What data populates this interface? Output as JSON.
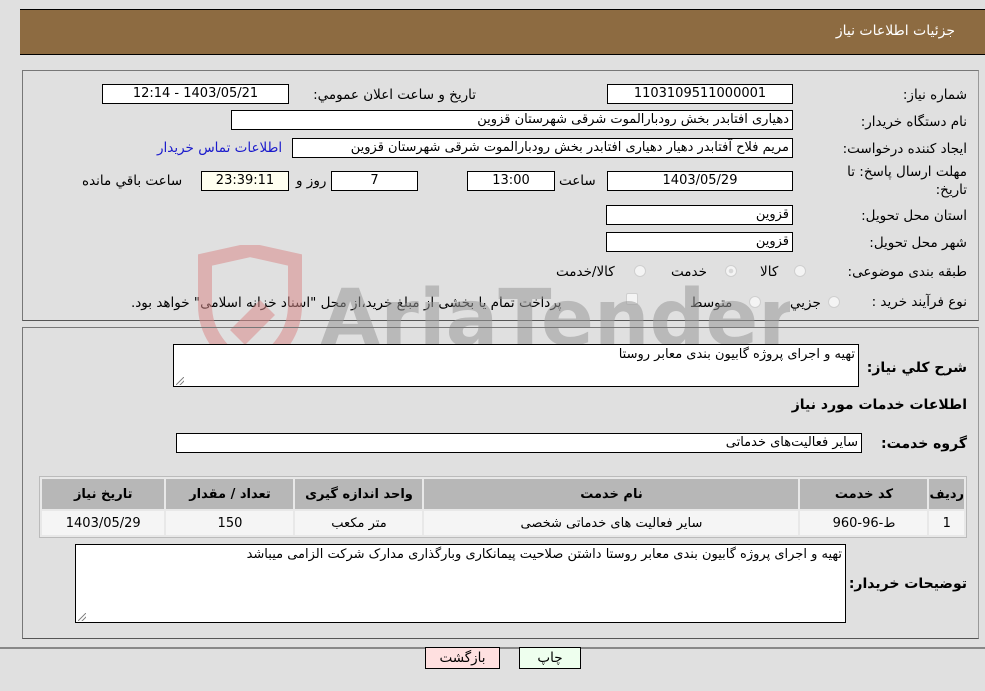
{
  "header": {
    "title": "جزئیات اطلاعات نیاز"
  },
  "details": {
    "need_number_label": "شماره نیاز:",
    "need_number": "1103109511000001",
    "announce_label": "تاریخ و ساعت اعلان عمومي:",
    "announce_value": "1403/05/21 - 12:14",
    "buyer_org_label": "نام دستگاه خریدار:",
    "buyer_org": "دهیاری افتابدر بخش رودبارالموت شرقی شهرستان قزوین",
    "creator_label": "ایجاد کننده درخواست:",
    "creator": "مریم فلاح آفتابدر دهیار دهیاری افتابدر بخش رودبارالموت شرقی شهرستان قزوین",
    "contact_link": "اطلاعات تماس خریدار",
    "deadline_label_line1": "مهلت ارسال پاسخ: تا",
    "deadline_label_line2": "تاریخ:",
    "deadline_date": "1403/05/29",
    "time_label": "ساعت",
    "deadline_time": "13:00",
    "days_value": "7",
    "days_label": "روز و",
    "remaining_time": "23:39:11",
    "remaining_label": "ساعت باقي مانده",
    "province_label": "استان محل تحویل:",
    "province": "قزوین",
    "city_label": "شهر محل تحویل:",
    "city": "قزوین",
    "category_label": "طبقه بندی موضوعی:",
    "category_options": [
      {
        "label": "کالا",
        "selected": false
      },
      {
        "label": "خدمت",
        "selected": true
      },
      {
        "label": "کالا/خدمت",
        "selected": false
      }
    ],
    "process_label": "نوع فرآیند خرید :",
    "process_options": [
      {
        "label": "جزيي",
        "selected": false
      },
      {
        "label": "متوسط",
        "selected": false
      }
    ],
    "treasury_note": "پرداخت تمام یا بخشی از مبلغ خرید،از محل \"اسناد خزانه اسلامی\" خواهد بود.",
    "treasury_checked": false
  },
  "services": {
    "summary_label": "شرح کلي نیاز:",
    "summary": "تهیه و اجرای پروژه گابیون بندی معابر روستا",
    "section_title": "اطلاعات خدمات مورد نیاز",
    "group_label": "گروه خدمت:",
    "group_value": "سایر فعالیت‌های خدماتی",
    "table": {
      "headers": [
        "ردیف",
        "کد خدمت",
        "نام خدمت",
        "واحد اندازه گیری",
        "تعداد / مقدار",
        "تاریخ نیاز"
      ],
      "rows": [
        [
          "1",
          "ط-96-960",
          "سایر فعالیت های خدماتی شخصی",
          "متر مکعب",
          "150",
          "1403/05/29"
        ]
      ]
    },
    "buyer_notes_label": "توضیحات خریدار:",
    "buyer_notes": "تهیه و اجرای پروژه گابیون بندی معابر روستا داشتن صلاحیت پیمانکاری وبارگذاری  مدارک شرکت الزامی میباشد"
  },
  "buttons": {
    "print": "چاپ",
    "back": "بازگشت"
  },
  "watermark": {
    "text": "AriaTender.neT"
  },
  "colors": {
    "header_bg": "#8d6b41",
    "link": "#1a1acc",
    "back_btn": "#ffe0e0",
    "print_btn": "#eeffee",
    "remaining_bg": "#fffff0"
  }
}
